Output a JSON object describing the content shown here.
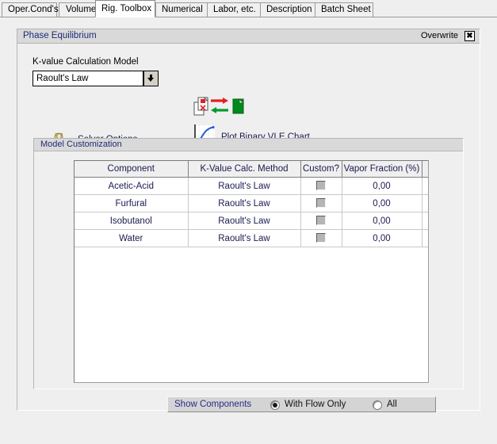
{
  "tabs": [
    {
      "label": "Oper.Cond's",
      "active": false
    },
    {
      "label": "Volumes",
      "active": false
    },
    {
      "label": "Rig. Toolbox",
      "active": true
    },
    {
      "label": "Numerical",
      "active": false
    },
    {
      "label": "Labor, etc.",
      "active": false
    },
    {
      "label": "Description",
      "active": false
    },
    {
      "label": "Batch Sheet",
      "active": false
    }
  ],
  "panel": {
    "title": "Phase Equilibrium",
    "overwrite_label": "Overwrite",
    "overwrite_mark": "✖",
    "overwrite_checked": true
  },
  "kvalue": {
    "label": "K-value Calculation Model",
    "selected": "Raoult's Law",
    "dropdown_icon": "chevron-down-icon"
  },
  "toolbar_icons": {
    "copy_paste_exchange": "copy-paste-exchange-icon"
  },
  "solver": {
    "label": "Solver Options",
    "icon": "gear-icon"
  },
  "plot": {
    "label": "Plot Binary VLE Chart",
    "icon": "line-chart-icon"
  },
  "model_customization": {
    "title": "Model Customization",
    "columns": [
      "Component",
      "K-Value Calc. Method",
      "Custom?",
      "Vapor Fraction (%)"
    ],
    "rows": [
      {
        "component": "Acetic-Acid",
        "method": "Raoult's Law",
        "custom": false,
        "vapor_fraction": "0,00"
      },
      {
        "component": "Furfural",
        "method": "Raoult's Law",
        "custom": false,
        "vapor_fraction": "0,00"
      },
      {
        "component": "Isobutanol",
        "method": "Raoult's Law",
        "custom": false,
        "vapor_fraction": "0,00"
      },
      {
        "component": "Water",
        "method": "Raoult's Law",
        "custom": false,
        "vapor_fraction": "0,00"
      }
    ]
  },
  "footer": {
    "label": "Show Components",
    "options": [
      {
        "label": "With Flow Only",
        "selected": true
      },
      {
        "label": "All",
        "selected": false
      }
    ]
  },
  "colors": {
    "window_bg": "#efefef",
    "header_bg": "#d9d9d9",
    "header_text": "#1f2a77",
    "grid_text": "#1b1b50",
    "link_text": "#2a2a88",
    "red": "#e02020",
    "green": "#008000",
    "blue": "#2255cc",
    "gold": "#e8d44a"
  }
}
